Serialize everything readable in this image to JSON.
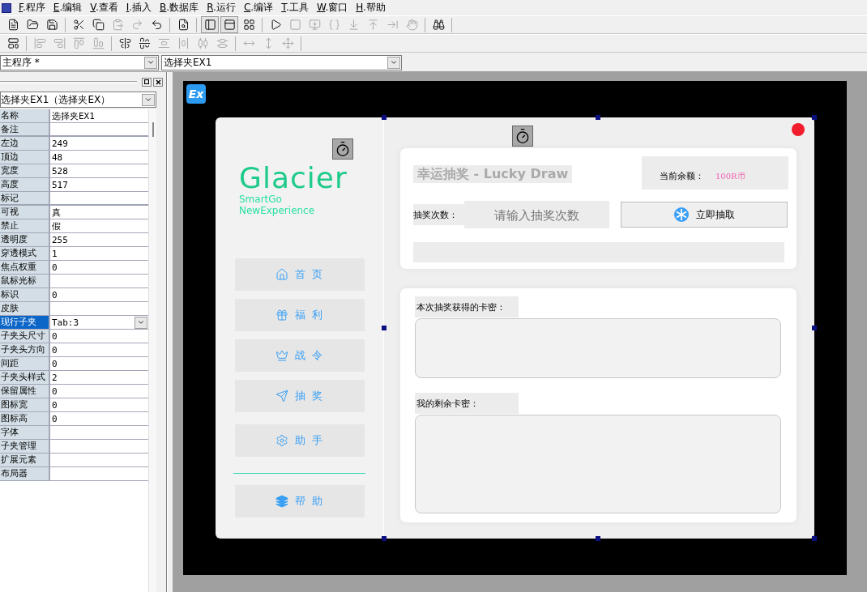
{
  "menu": [
    {
      "label": "F.程序"
    },
    {
      "label": "E.编辑"
    },
    {
      "label": "V.查看"
    },
    {
      "label": "I.插入"
    },
    {
      "label": "B.数据库"
    },
    {
      "label": "R.运行"
    },
    {
      "label": "C.编译"
    },
    {
      "label": "T.工具"
    },
    {
      "label": "W.窗口"
    },
    {
      "label": "H.帮助"
    }
  ],
  "toolbar_1": [
    [
      {
        "disabled": false,
        "pressed": false
      },
      {
        "disabled": false,
        "pressed": false
      },
      {
        "disabled": false,
        "pressed": false
      }
    ],
    [
      {
        "disabled": false,
        "pressed": false
      },
      {
        "disabled": false,
        "pressed": false
      },
      {
        "disabled": true,
        "pressed": false
      },
      {
        "disabled": true,
        "pressed": false
      },
      {
        "disabled": false,
        "pressed": false
      }
    ],
    [
      {
        "disabled": false,
        "pressed": false
      }
    ],
    [
      {
        "disabled": false,
        "pressed": true
      },
      {
        "disabled": false,
        "pressed": true
      },
      {
        "disabled": false,
        "pressed": false
      }
    ],
    [
      {
        "disabled": false,
        "pressed": false
      },
      {
        "disabled": true,
        "pressed": false
      },
      {
        "disabled": true,
        "pressed": false
      },
      {
        "disabled": true,
        "pressed": false
      },
      {
        "disabled": true,
        "pressed": false
      },
      {
        "disabled": true,
        "pressed": false
      },
      {
        "disabled": true,
        "pressed": false
      },
      {
        "disabled": true,
        "pressed": false
      }
    ],
    [
      {
        "disabled": false,
        "pressed": false
      }
    ]
  ],
  "toolbar_2": [
    [
      {
        "disabled": false,
        "pressed": false
      }
    ],
    [
      {
        "disabled": true,
        "pressed": false
      },
      {
        "disabled": true,
        "pressed": false
      },
      {
        "disabled": true,
        "pressed": false
      },
      {
        "disabled": true,
        "pressed": false
      }
    ],
    [
      {
        "disabled": false,
        "pressed": false
      },
      {
        "disabled": false,
        "pressed": false
      },
      {
        "disabled": true,
        "pressed": false
      },
      {
        "disabled": true,
        "pressed": false
      },
      {
        "disabled": true,
        "pressed": false
      },
      {
        "disabled": true,
        "pressed": false
      }
    ],
    [
      {
        "disabled": true,
        "pressed": false
      },
      {
        "disabled": true,
        "pressed": false
      },
      {
        "disabled": true,
        "pressed": false
      }
    ]
  ],
  "selectors": [
    {
      "value": "主程序 *"
    },
    {
      "value": "选择夹EX1"
    }
  ],
  "properties": {
    "object": "选择夹EX1（选择夹EX）",
    "rows": [
      {
        "label": "名称",
        "value": "选择夹EX1",
        "selected": false,
        "section_end": false
      },
      {
        "label": "备注",
        "value": "",
        "selected": false,
        "section_end": true
      },
      {
        "label": "左边",
        "value": "249",
        "selected": false,
        "section_end": false
      },
      {
        "label": "顶边",
        "value": "48",
        "selected": false,
        "section_end": false
      },
      {
        "label": "宽度",
        "value": "528",
        "selected": false,
        "section_end": false
      },
      {
        "label": "高度",
        "value": "517",
        "selected": false,
        "section_end": false
      },
      {
        "label": "标记",
        "value": "",
        "selected": false,
        "section_end": true
      },
      {
        "label": "可视",
        "value": "真",
        "selected": false,
        "section_end": false
      },
      {
        "label": "禁止",
        "value": "假",
        "selected": false,
        "section_end": false
      },
      {
        "label": "透明度",
        "value": "255",
        "selected": false,
        "section_end": false
      },
      {
        "label": "穿透模式",
        "value": "1",
        "selected": false,
        "section_end": false
      },
      {
        "label": "焦点权重",
        "value": "0",
        "selected": false,
        "section_end": false
      },
      {
        "label": "鼠标光标",
        "value": "",
        "selected": false,
        "section_end": false
      },
      {
        "label": "标识",
        "value": "0",
        "selected": false,
        "section_end": false
      },
      {
        "label": "皮肤",
        "value": "",
        "selected": false,
        "section_end": false
      },
      {
        "label": "现行子夹",
        "value": "Tab:3",
        "selected": true,
        "section_end": false
      },
      {
        "label": "子夹头尺寸",
        "value": "0",
        "selected": false,
        "section_end": false
      },
      {
        "label": "子夹头方向",
        "value": "0",
        "selected": false,
        "section_end": false
      },
      {
        "label": "间距",
        "value": "0",
        "selected": false,
        "section_end": false
      },
      {
        "label": "子夹头样式",
        "value": "2",
        "selected": false,
        "section_end": false
      },
      {
        "label": "保留属性",
        "value": "0",
        "selected": false,
        "section_end": false
      },
      {
        "label": "图标宽",
        "value": "0",
        "selected": false,
        "section_end": false
      },
      {
        "label": "图标高",
        "value": "0",
        "selected": false,
        "section_end": false
      },
      {
        "label": "字体",
        "value": "",
        "selected": false,
        "section_end": false
      },
      {
        "label": "子夹管理",
        "value": "",
        "selected": false,
        "section_end": false
      },
      {
        "label": "扩展元素",
        "value": "",
        "selected": false,
        "section_end": false
      },
      {
        "label": "布局器",
        "value": "",
        "selected": false,
        "section_end": false
      }
    ]
  },
  "canvas": {
    "badge": "Ex",
    "sidebar": {
      "brand": "Glacier",
      "tagline_1": "SmartGo",
      "tagline_2": "NewExperience",
      "nav": [
        {
          "label": "首 页"
        },
        {
          "label": "福 利"
        },
        {
          "label": "战 令"
        },
        {
          "label": "抽 奖"
        },
        {
          "label": "助 手"
        }
      ],
      "footer_item": {
        "label": "帮 助"
      }
    },
    "draw_card": {
      "title": "幸运抽奖 - Lucky Draw",
      "balance_label": "当前余额：",
      "balance_value": "100R币",
      "count_label": "抽奖次数：",
      "count_placeholder": "请输入抽奖次数",
      "draw_button": "立即抽取"
    },
    "keys_card": {
      "current_label": "本次抽奖获得的卡密：",
      "remaining_label": "我的剩余卡密："
    }
  }
}
